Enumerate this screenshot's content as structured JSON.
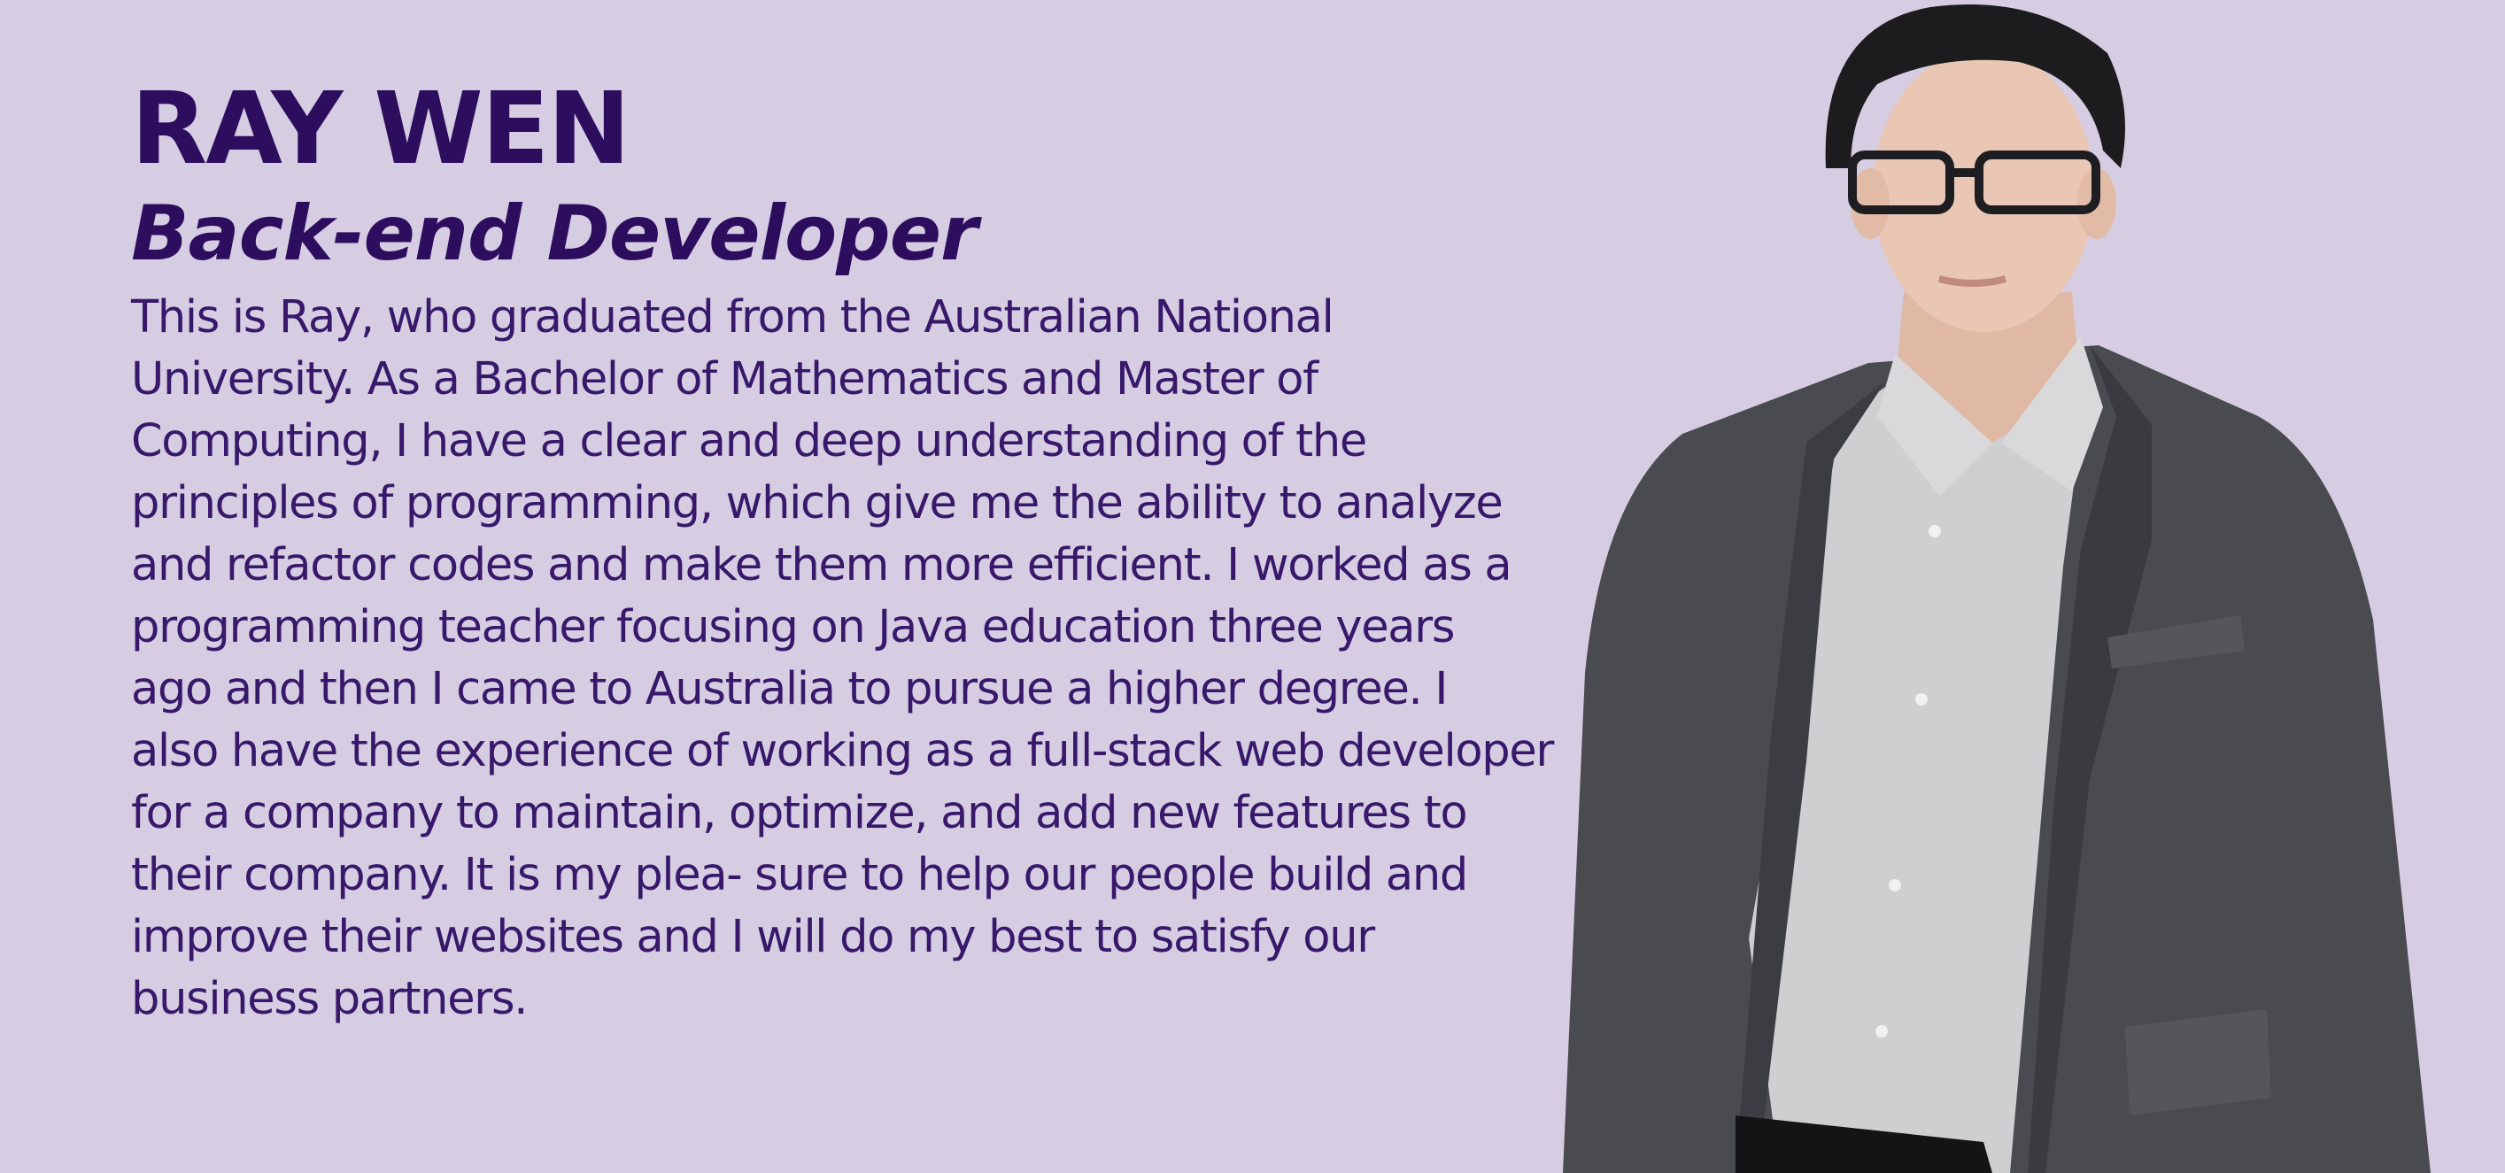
{
  "profile": {
    "name": "RAY WEN",
    "title": "Back-end Developer",
    "bio_lines": [
      "This is Ray, who graduated from the Australian National",
      "University. As a Bachelor of Mathematics and Master of",
      "Computing, I have a clear and deep understanding of the",
      "principles of programming, which give me the ability to analyze",
      "and refactor codes and make them more efficient. I worked as a",
      "programming teacher focusing on Java education three years",
      "ago and then I came to Australia to pursue a higher degree. I",
      "also have the experience of working as a full-stack web developer",
      "for a company to maintain, optimize, and add new features to",
      "their company. It is my plea- sure to help our people build and",
      "improve their websites and I will do my best to satisfy our",
      "business partners."
    ]
  },
  "colors": {
    "background": "#d6cde2",
    "heading": "#2c0d5e",
    "body_text": "#37186a",
    "jacket": "#4a4b50",
    "shirt": "#cfcfd2",
    "hair": "#1c1c1f",
    "skin": "#e9c7b4"
  },
  "icons": {
    "portrait": "person-portrait-icon"
  }
}
